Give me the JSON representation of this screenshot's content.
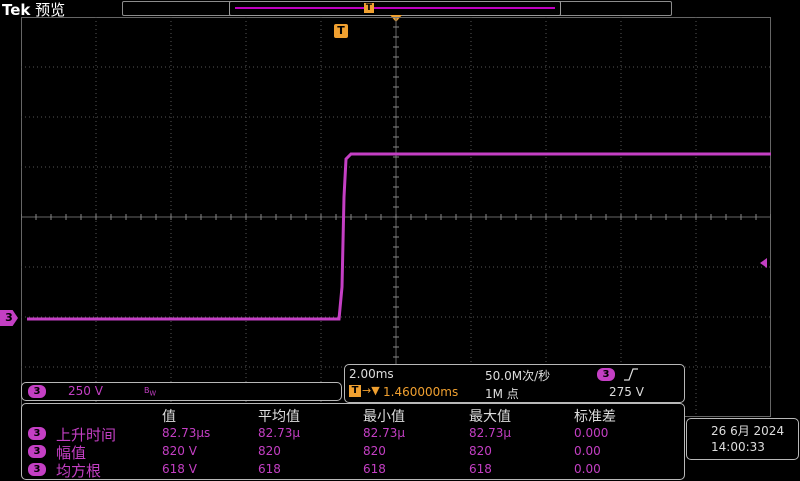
{
  "header": {
    "brand": "Tek",
    "mode": "预览",
    "record_trigger_marker": "T"
  },
  "trigger_marker": "T",
  "channel": {
    "id": "3",
    "scale": "250 V",
    "coupling_icon": "bandwidth-limit-icon",
    "color": "#c43fc4"
  },
  "timebase": {
    "scale": "2.00ms",
    "sample_rate": "50.0M次/秒",
    "position": "1.460000ms",
    "record_length": "1M 点"
  },
  "trigger": {
    "source": "3",
    "slope_icon": "rising-edge-icon",
    "level": "275 V",
    "color": "#f0a030"
  },
  "measurements": {
    "headers": [
      "值",
      "平均值",
      "最小值",
      "最大值",
      "标准差"
    ],
    "rows": [
      {
        "ch": "3",
        "name": "上升时间",
        "values": [
          "82.73µs",
          "82.73µ",
          "82.73µ",
          "82.73µ",
          "0.000"
        ]
      },
      {
        "ch": "3",
        "name": "幅值",
        "values": [
          "820 V",
          "820",
          "820",
          "820",
          "0.00"
        ]
      },
      {
        "ch": "3",
        "name": "均方根",
        "values": [
          "618 V",
          "618",
          "618",
          "618",
          "0.00"
        ]
      }
    ]
  },
  "datetime": {
    "date": "26 6月 2024",
    "time": "14:00:33"
  }
}
